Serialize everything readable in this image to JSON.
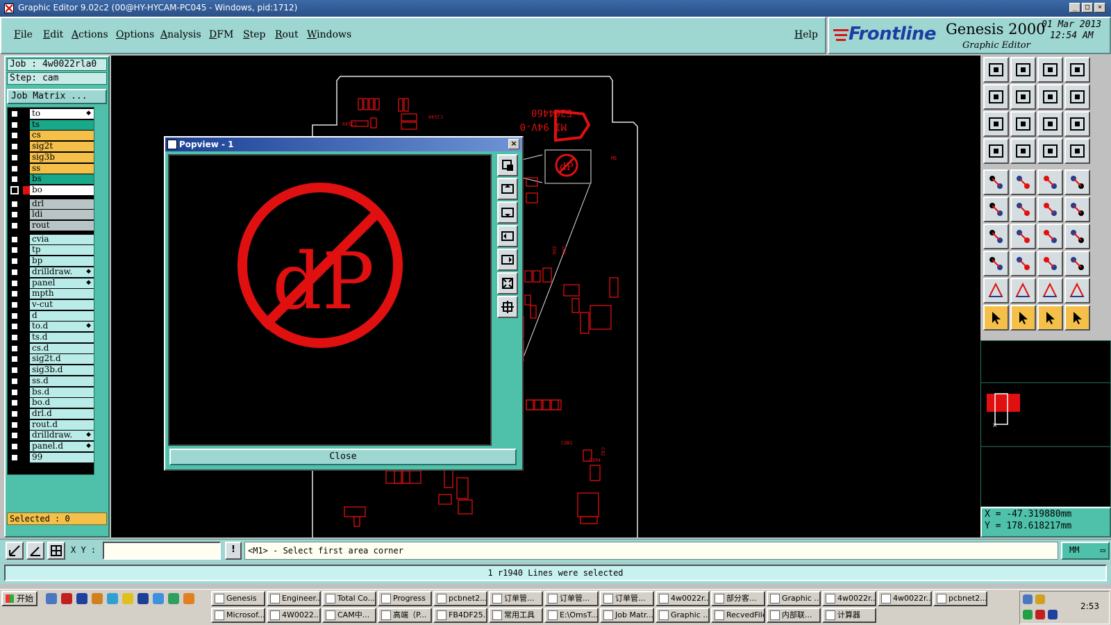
{
  "window": {
    "title": "Graphic Editor 9.02c2 (00@HY-HYCAM-PC045 - Windows, pid:1712)",
    "minimize": "_",
    "maximize": "□",
    "close": "×"
  },
  "menu": {
    "items": [
      "File",
      "Edit",
      "Actions",
      "Options",
      "Analysis",
      "DFM",
      "Step",
      "Rout",
      "Windows"
    ],
    "help": "Help"
  },
  "brand": {
    "logo": "Frontline",
    "product": "Genesis 2000",
    "subtitle": "Graphic Editor",
    "date": "01 Mar 2013",
    "time": "12:54 AM"
  },
  "job": {
    "job_label": "Job : 4w0022rla0",
    "step_label": "Step: cam",
    "matrix_button": "Job Matrix ..."
  },
  "layers": [
    {
      "name": "to",
      "color": "#ffffff",
      "arrow": true
    },
    {
      "name": "ts",
      "color": "#1aa88a",
      "arrow": false
    },
    {
      "name": "cs",
      "color": "#f5c04a",
      "arrow": false
    },
    {
      "name": "sig2t",
      "color": "#f5c04a",
      "arrow": false
    },
    {
      "name": "sig3b",
      "color": "#f5c04a",
      "arrow": false
    },
    {
      "name": "ss",
      "color": "#f5c04a",
      "arrow": false
    },
    {
      "name": "bs",
      "color": "#1aa88a",
      "arrow": false
    },
    {
      "name": "bo",
      "color": "#ffffff",
      "arrow": false,
      "active": true
    },
    {
      "name": "drl",
      "color": "#b8c4c6",
      "arrow": false
    },
    {
      "name": "ldi",
      "color": "#b8c4c6",
      "arrow": false
    },
    {
      "name": "rout",
      "color": "#b8c4c6",
      "arrow": false
    },
    {
      "name": "cvia",
      "color": "#b9ece8",
      "arrow": false
    },
    {
      "name": "tp",
      "color": "#b9ece8",
      "arrow": false
    },
    {
      "name": "bp",
      "color": "#b9ece8",
      "arrow": false
    },
    {
      "name": "drilldraw.",
      "color": "#b9ece8",
      "arrow": true
    },
    {
      "name": "panel",
      "color": "#b9ece8",
      "arrow": true
    },
    {
      "name": "mpth",
      "color": "#b9ece8",
      "arrow": false
    },
    {
      "name": "v-cut",
      "color": "#b9ece8",
      "arrow": false
    },
    {
      "name": "d",
      "color": "#b9ece8",
      "arrow": false
    },
    {
      "name": "to.d",
      "color": "#b9ece8",
      "arrow": true
    },
    {
      "name": "ts.d",
      "color": "#b9ece8",
      "arrow": false
    },
    {
      "name": "cs.d",
      "color": "#b9ece8",
      "arrow": false
    },
    {
      "name": "sig2t.d",
      "color": "#b9ece8",
      "arrow": false
    },
    {
      "name": "sig3b.d",
      "color": "#b9ece8",
      "arrow": false
    },
    {
      "name": "ss.d",
      "color": "#b9ece8",
      "arrow": false
    },
    {
      "name": "bs.d",
      "color": "#b9ece8",
      "arrow": false
    },
    {
      "name": "bo.d",
      "color": "#b9ece8",
      "arrow": false
    },
    {
      "name": "drl.d",
      "color": "#b9ece8",
      "arrow": false
    },
    {
      "name": "rout.d",
      "color": "#b9ece8",
      "arrow": false
    },
    {
      "name": "drilldraw.",
      "color": "#b9ece8",
      "arrow": true
    },
    {
      "name": "panel.d",
      "color": "#b9ece8",
      "arrow": true
    },
    {
      "name": "99",
      "color": "#b9ece8",
      "arrow": false
    }
  ],
  "selected_label": "Selected : 0",
  "board_text": {
    "part_number": "E204460",
    "rating": "MI 94V-0"
  },
  "popview": {
    "title": "Popview - 1",
    "close_button": "Close"
  },
  "coords": {
    "x": "X = -47.319880mm",
    "y": "Y = 178.618217mm"
  },
  "command": {
    "xy_label": "X Y :",
    "xy_value": "",
    "prompt": "<M1> - Select first area corner",
    "units": "MM"
  },
  "status_message": "1 r1940 Lines were selected",
  "taskbar": {
    "start": "开始",
    "row1": [
      "Genesis",
      "Engineer...",
      "Total Co...",
      "Progress",
      "pcbnet2...",
      "订单管...",
      "订单管...",
      "订单管...",
      "4w0022r...",
      "部分客...",
      "Graphic ...",
      "4w0022r...",
      "4w0022r...",
      "pcbnet2..."
    ],
    "row2": [
      "Microsof...",
      "4W0022...",
      "CAM中...",
      "高端（P...",
      "FB4DF25...",
      "常用工具",
      "E:\\OmsT...",
      "Job Matr...",
      "Graphic ...",
      "RecvedFile",
      "内部联...",
      "计算器"
    ],
    "clock": "2:53"
  },
  "colors": {
    "accent": "#4fc0aa",
    "menu_bg": "#9ed6d2",
    "board_red": "#e01010",
    "yellow": "#f5c04a"
  }
}
